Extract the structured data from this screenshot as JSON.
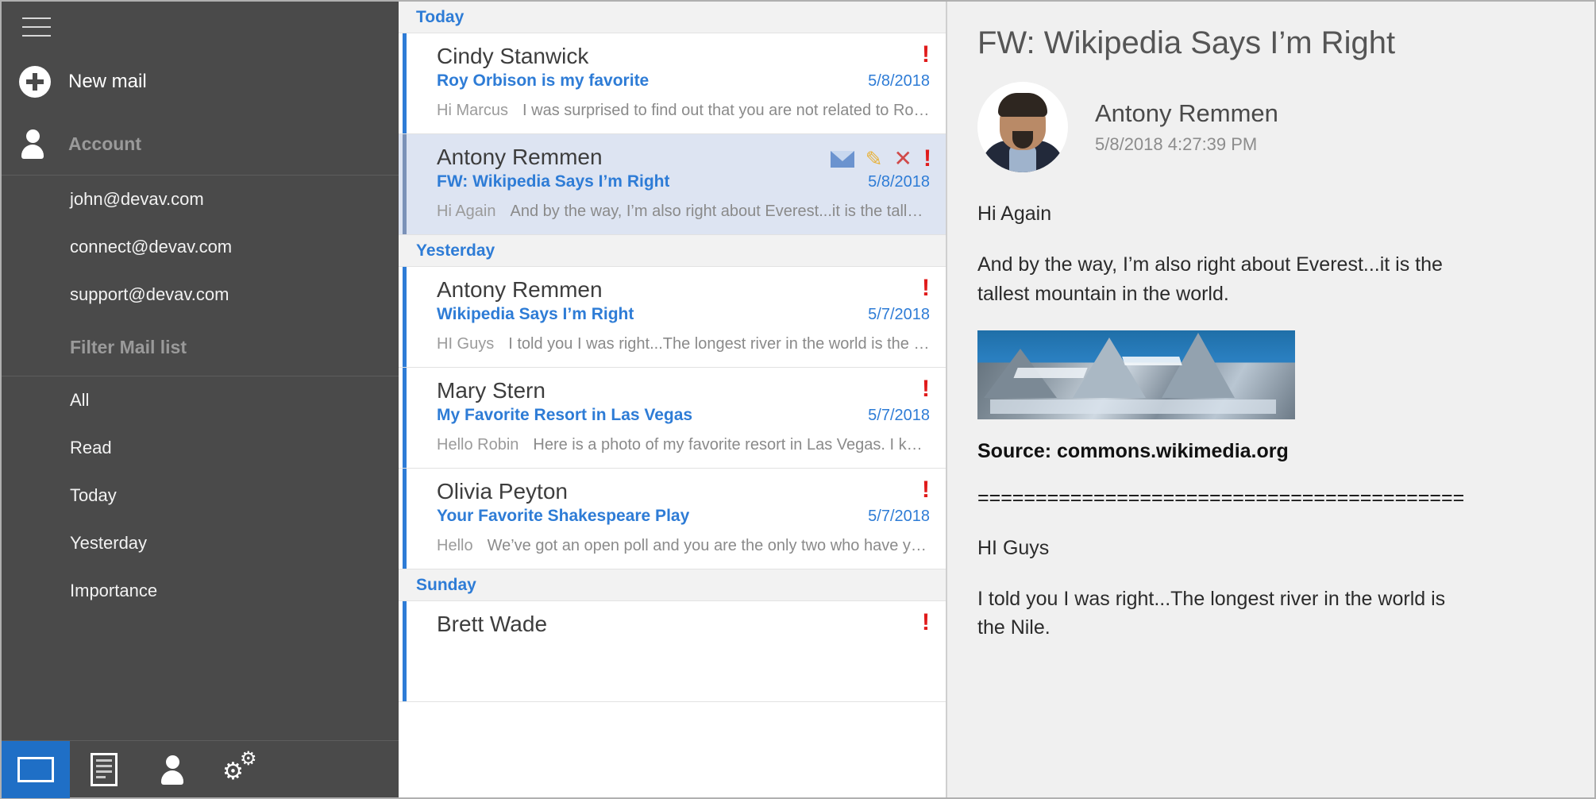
{
  "sidebar": {
    "menu_icon": "hamburger-icon",
    "new_mail": {
      "label": "New mail",
      "icon": "plus-circle-icon"
    },
    "account": {
      "label": "Account",
      "icon": "person-icon"
    },
    "accounts": [
      {
        "label": "john@devav.com"
      },
      {
        "label": "connect@devav.com"
      },
      {
        "label": "support@devav.com"
      }
    ],
    "filter_header": "Filter Mail list",
    "filters": [
      {
        "label": "All"
      },
      {
        "label": "Read"
      },
      {
        "label": "Today"
      },
      {
        "label": "Yesterday"
      },
      {
        "label": "Importance"
      }
    ],
    "bottom_nav": [
      {
        "name": "mail",
        "icon": "envelope-icon",
        "active": true
      },
      {
        "name": "documents",
        "icon": "document-icon",
        "active": false
      },
      {
        "name": "contacts",
        "icon": "person-icon",
        "active": false
      },
      {
        "name": "settings",
        "icon": "gears-icon",
        "active": false
      }
    ]
  },
  "mail_list": {
    "groups": [
      {
        "title": "Today",
        "items": [
          {
            "from": "Cindy Stanwick",
            "subject": "Roy Orbison is my favorite",
            "date": "5/8/2018",
            "preview_lead": "Hi Marcus",
            "preview": "I was surprised to find out that you are not related to Roy Or...",
            "important": true,
            "selected": false
          },
          {
            "from": "Antony Remmen",
            "subject": "FW: Wikipedia Says I’m Right",
            "date": "5/8/2018",
            "preview_lead": "Hi Again",
            "preview": "And by the way, I’m also right about Everest...it is the tallest mo...",
            "important": true,
            "selected": true,
            "actions": [
              "envelope-icon",
              "pencil-icon",
              "close-icon",
              "importance-icon"
            ]
          }
        ]
      },
      {
        "title": "Yesterday",
        "items": [
          {
            "from": "Antony Remmen",
            "subject": "Wikipedia Says I’m Right",
            "date": "5/7/2018",
            "preview_lead": "HI Guys",
            "preview": "I told you I was right...The longest river in the world is the Nile.  ...",
            "important": true,
            "selected": false
          },
          {
            "from": "Mary Stern",
            "subject": "My Favorite Resort in Las Vegas",
            "date": "5/7/2018",
            "preview_lead": "Hello Robin",
            "preview": "Here is a photo of my favorite resort in Las Vegas.      I kno...",
            "important": true,
            "selected": false
          },
          {
            "from": "Olivia Peyton",
            "subject": "Your Favorite Shakespeare Play",
            "date": "5/7/2018",
            "preview_lead": "Hello",
            "preview": "We’ve got an open poll and you are the only two who have yet to...",
            "important": true,
            "selected": false
          }
        ]
      },
      {
        "title": "Sunday",
        "items": [
          {
            "from": "Brett Wade",
            "subject": "",
            "date": "",
            "preview_lead": "",
            "preview": "",
            "important": true,
            "selected": false
          }
        ]
      }
    ]
  },
  "preview": {
    "title": "FW: Wikipedia Says I’m Right",
    "sender": "Antony Remmen",
    "timestamp": "5/8/2018 4:27:39 PM",
    "avatar": "sender-photo",
    "greeting": "Hi Again",
    "body1": "And by the way, I’m also right about Everest...it is the tallest mountain in the world.",
    "image": "mount-everest-photo",
    "source": "Source: commons.wikimedia.org",
    "divider": "==========================================",
    "greeting2": "HI Guys",
    "body2": "I told you I was right...The longest river in the world is the Nile."
  },
  "colors": {
    "accent_blue": "#2e7cd6",
    "sidebar_bg": "#4a4a4a",
    "selected_row": "#dde4f2",
    "important_red": "#e01b1b",
    "nav_active": "#1f6fc6"
  }
}
